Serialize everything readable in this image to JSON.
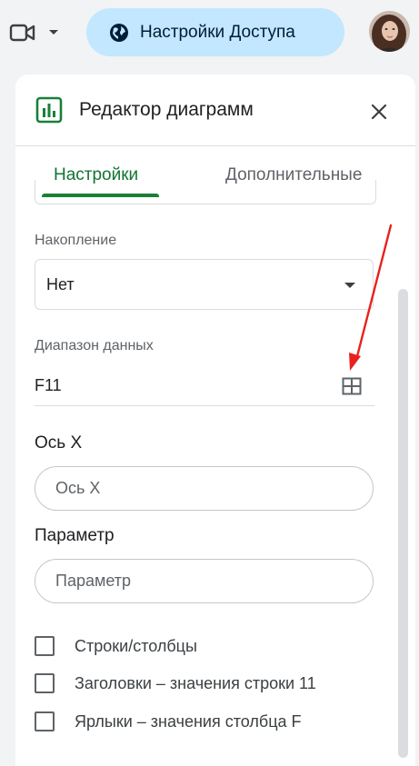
{
  "topbar": {
    "camera_icon": "video-camera-icon",
    "share_button_label": "Настройки Доступа",
    "globe_icon": "globe-icon"
  },
  "editor": {
    "title": "Редактор диаграмм",
    "tabs": [
      {
        "label": "Настройки",
        "active": true
      },
      {
        "label": "Дополнительные",
        "active": false
      }
    ],
    "stacking": {
      "label": "Накопление",
      "value": "Нет"
    },
    "data_range": {
      "label": "Диапазон данных",
      "value": "F11"
    },
    "x_axis": {
      "label": "Ось X",
      "placeholder": "Ось X"
    },
    "parameter": {
      "label": "Параметр",
      "placeholder": "Параметр"
    },
    "checkboxes": [
      {
        "label": "Строки/столбцы",
        "checked": false
      },
      {
        "label": "Заголовки – значения строки 11",
        "checked": false
      },
      {
        "label": "Ярлыки – значения столбца F",
        "checked": false
      }
    ]
  },
  "colors": {
    "accent_green": "#188038",
    "share_button_bg": "#c2e7ff",
    "annotation_arrow": "#e8211d"
  }
}
